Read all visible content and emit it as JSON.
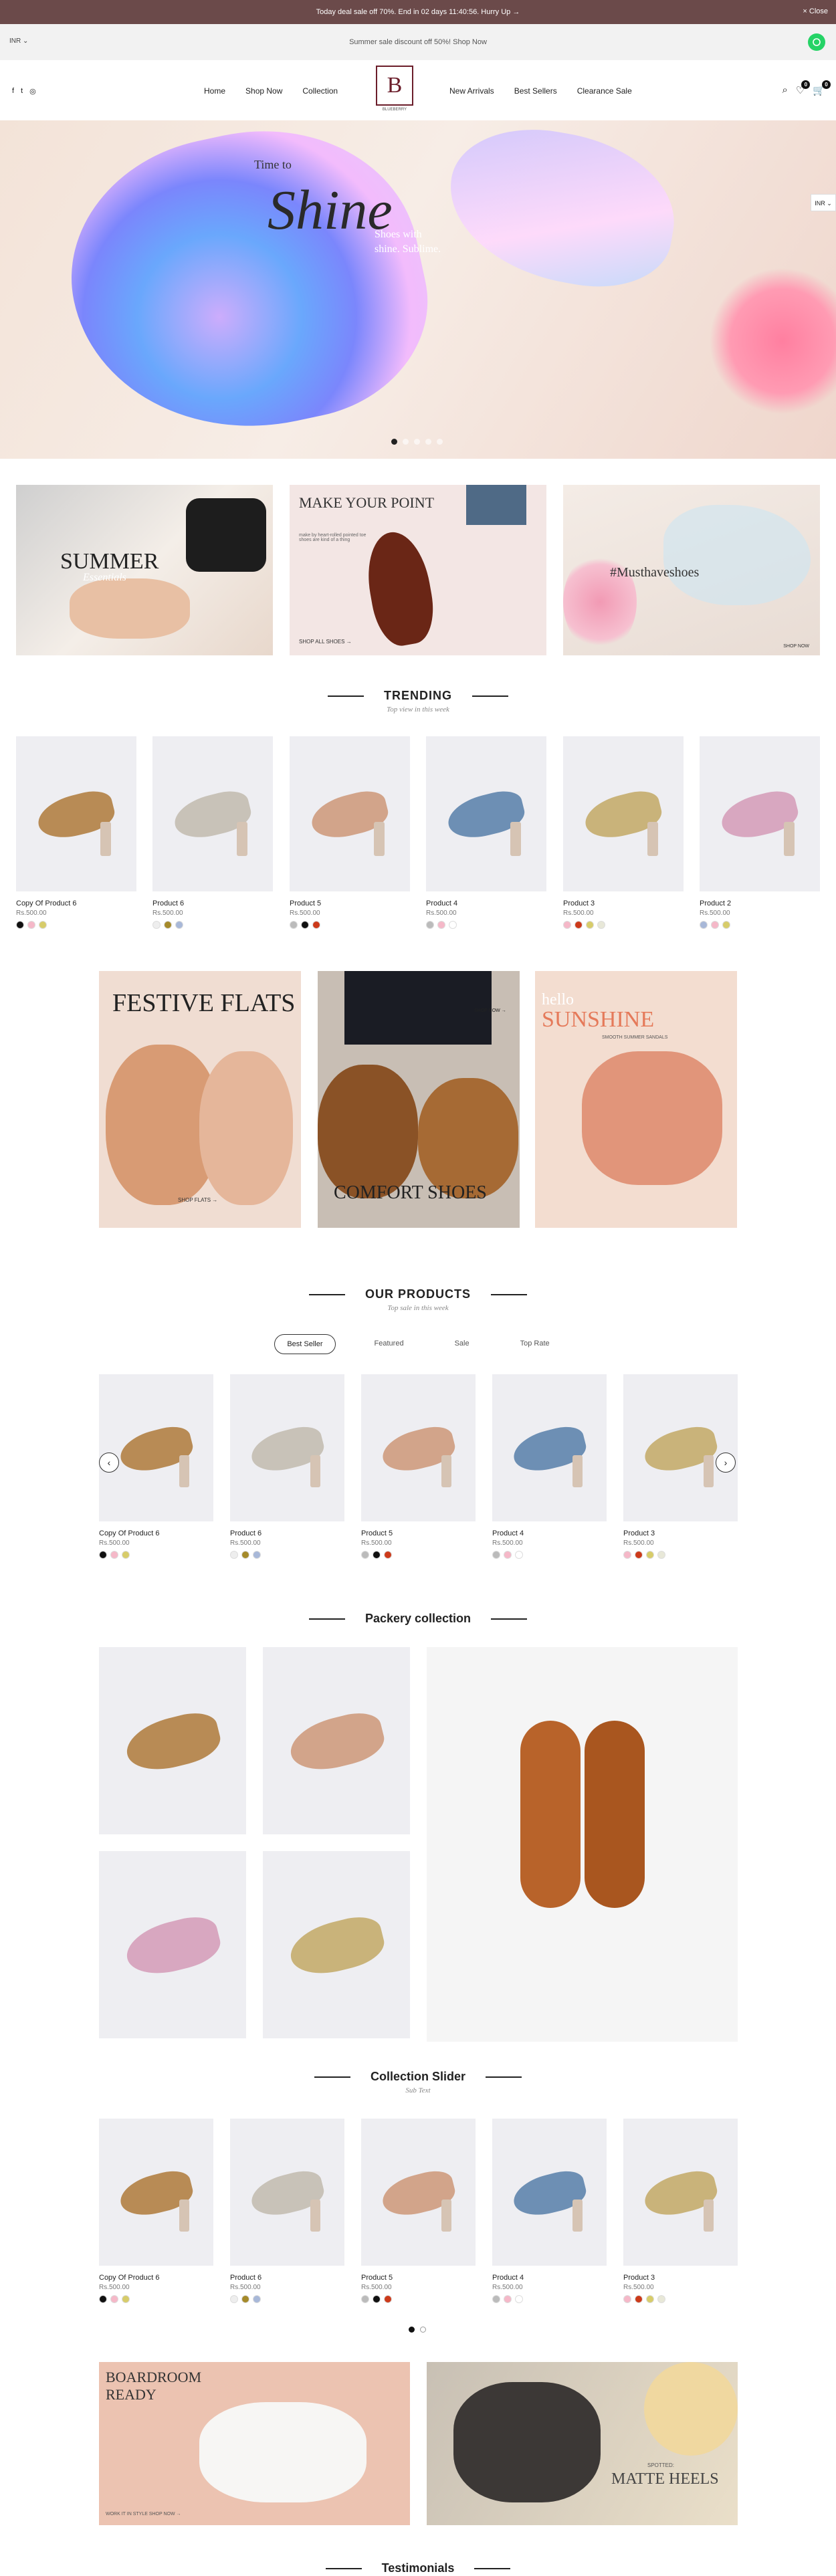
{
  "topbar": {
    "message": "Today deal sale off 70%. End in 02 days 11:40:56. Hurry Up →",
    "close": "× Close"
  },
  "strip": {
    "currency": "INR ⌄",
    "promo": "Summer sale discount off 50%! Shop Now"
  },
  "nav": {
    "left": [
      "Home",
      "Shop Now",
      "Collection"
    ],
    "right": [
      "New Arrivals",
      "Best Sellers",
      "Clearance Sale"
    ]
  },
  "logo": {
    "letter": "B",
    "name": "BLUEBERRY",
    "tagline": "by Moissanite & Japanese Thereafter"
  },
  "cart": {
    "wishlist_count": "0",
    "cart_count": "0"
  },
  "hero": {
    "pre": "Time to",
    "title": "Shine",
    "sub1": "Shoes with",
    "sub2": "shine. Sublime.",
    "side_currency": "INR ⌄"
  },
  "banners": [
    {
      "title": "SUMMER",
      "sub": "Essentials"
    },
    {
      "title": "MAKE YOUR POINT",
      "sub": "make by heart-rolled pointed toe shoes are kind of a thing",
      "cta": "SHOP ALL SHOES →"
    },
    {
      "title": "#Musthaveshoes",
      "cta": "SHOP NOW"
    }
  ],
  "trending": {
    "title": "TRENDING",
    "sub": "Top view in this week",
    "items": [
      {
        "name": "Copy Of Product 6",
        "price": "Rs.500.00",
        "swatches": [
          "#111111",
          "#f5b8c8",
          "#d7cc6a"
        ]
      },
      {
        "name": "Product 6",
        "price": "Rs.500.00",
        "swatches": [
          "#eeeeee",
          "#a58a2a",
          "#a8b8d8"
        ]
      },
      {
        "name": "Product 5",
        "price": "Rs.500.00",
        "swatches": [
          "#bbbbbb",
          "#111111",
          "#cc3a1a"
        ]
      },
      {
        "name": "Product 4",
        "price": "Rs.500.00",
        "swatches": [
          "#bbbbbb",
          "#f5b8c8",
          "#ffffff"
        ]
      },
      {
        "name": "Product 3",
        "price": "Rs.500.00",
        "swatches": [
          "#f5b8c8",
          "#cc3a1a",
          "#d7cc6a",
          "#e8e8d8"
        ]
      },
      {
        "name": "Product 2",
        "price": "Rs.500.00",
        "swatches": [
          "#a8b8d8",
          "#f5b8c8",
          "#d7cc6a"
        ]
      }
    ]
  },
  "mid_banners": [
    {
      "title": "FESTIVE FLATS",
      "cta": "SHOP FLATS →"
    },
    {
      "title": "COMFORT SHOES",
      "cta": "SHOP NOW →"
    },
    {
      "title1": "hello",
      "title2": "SUNSHINE",
      "sub": "SMOOTH SUMMER SANDALS"
    }
  ],
  "our_products": {
    "title": "OUR PRODUCTS",
    "sub": "Top sale in this week",
    "tabs": [
      "Best Seller",
      "Featured",
      "Sale",
      "Top Rate"
    ],
    "items": [
      {
        "name": "Copy Of Product 6",
        "price": "Rs.500.00",
        "swatches": [
          "#111111",
          "#f5b8c8",
          "#d7cc6a"
        ]
      },
      {
        "name": "Product 6",
        "price": "Rs.500.00",
        "swatches": [
          "#eeeeee",
          "#a58a2a",
          "#a8b8d8"
        ]
      },
      {
        "name": "Product 5",
        "price": "Rs.500.00",
        "swatches": [
          "#bbbbbb",
          "#111111",
          "#cc3a1a"
        ]
      },
      {
        "name": "Product 4",
        "price": "Rs.500.00",
        "swatches": [
          "#bbbbbb",
          "#f5b8c8",
          "#ffffff"
        ]
      },
      {
        "name": "Product 3",
        "price": "Rs.500.00",
        "swatches": [
          "#f5b8c8",
          "#cc3a1a",
          "#d7cc6a",
          "#e8e8d8"
        ]
      }
    ]
  },
  "packery": {
    "title": "Packery collection"
  },
  "collection_slider": {
    "title": "Collection Slider",
    "sub": "Sub Text",
    "items": [
      {
        "name": "Copy Of Product 6",
        "price": "Rs.500.00",
        "swatches": [
          "#111111",
          "#f5b8c8",
          "#d7cc6a"
        ]
      },
      {
        "name": "Product 6",
        "price": "Rs.500.00",
        "swatches": [
          "#eeeeee",
          "#a58a2a",
          "#a8b8d8"
        ]
      },
      {
        "name": "Product 5",
        "price": "Rs.500.00",
        "swatches": [
          "#bbbbbb",
          "#111111",
          "#cc3a1a"
        ]
      },
      {
        "name": "Product 4",
        "price": "Rs.500.00",
        "swatches": [
          "#bbbbbb",
          "#f5b8c8",
          "#ffffff"
        ]
      },
      {
        "name": "Product 3",
        "price": "Rs.500.00",
        "swatches": [
          "#f5b8c8",
          "#cc3a1a",
          "#d7cc6a",
          "#e8e8d8"
        ]
      }
    ]
  },
  "bottom_banners": [
    {
      "title": "BOARDROOM READY",
      "cta": "WORK IT IN STYLE SHOP NOW →"
    },
    {
      "pre": "SPOTTED:",
      "title": "MATTE HEELS"
    }
  ],
  "testimonials": {
    "title": "Testimonials"
  }
}
